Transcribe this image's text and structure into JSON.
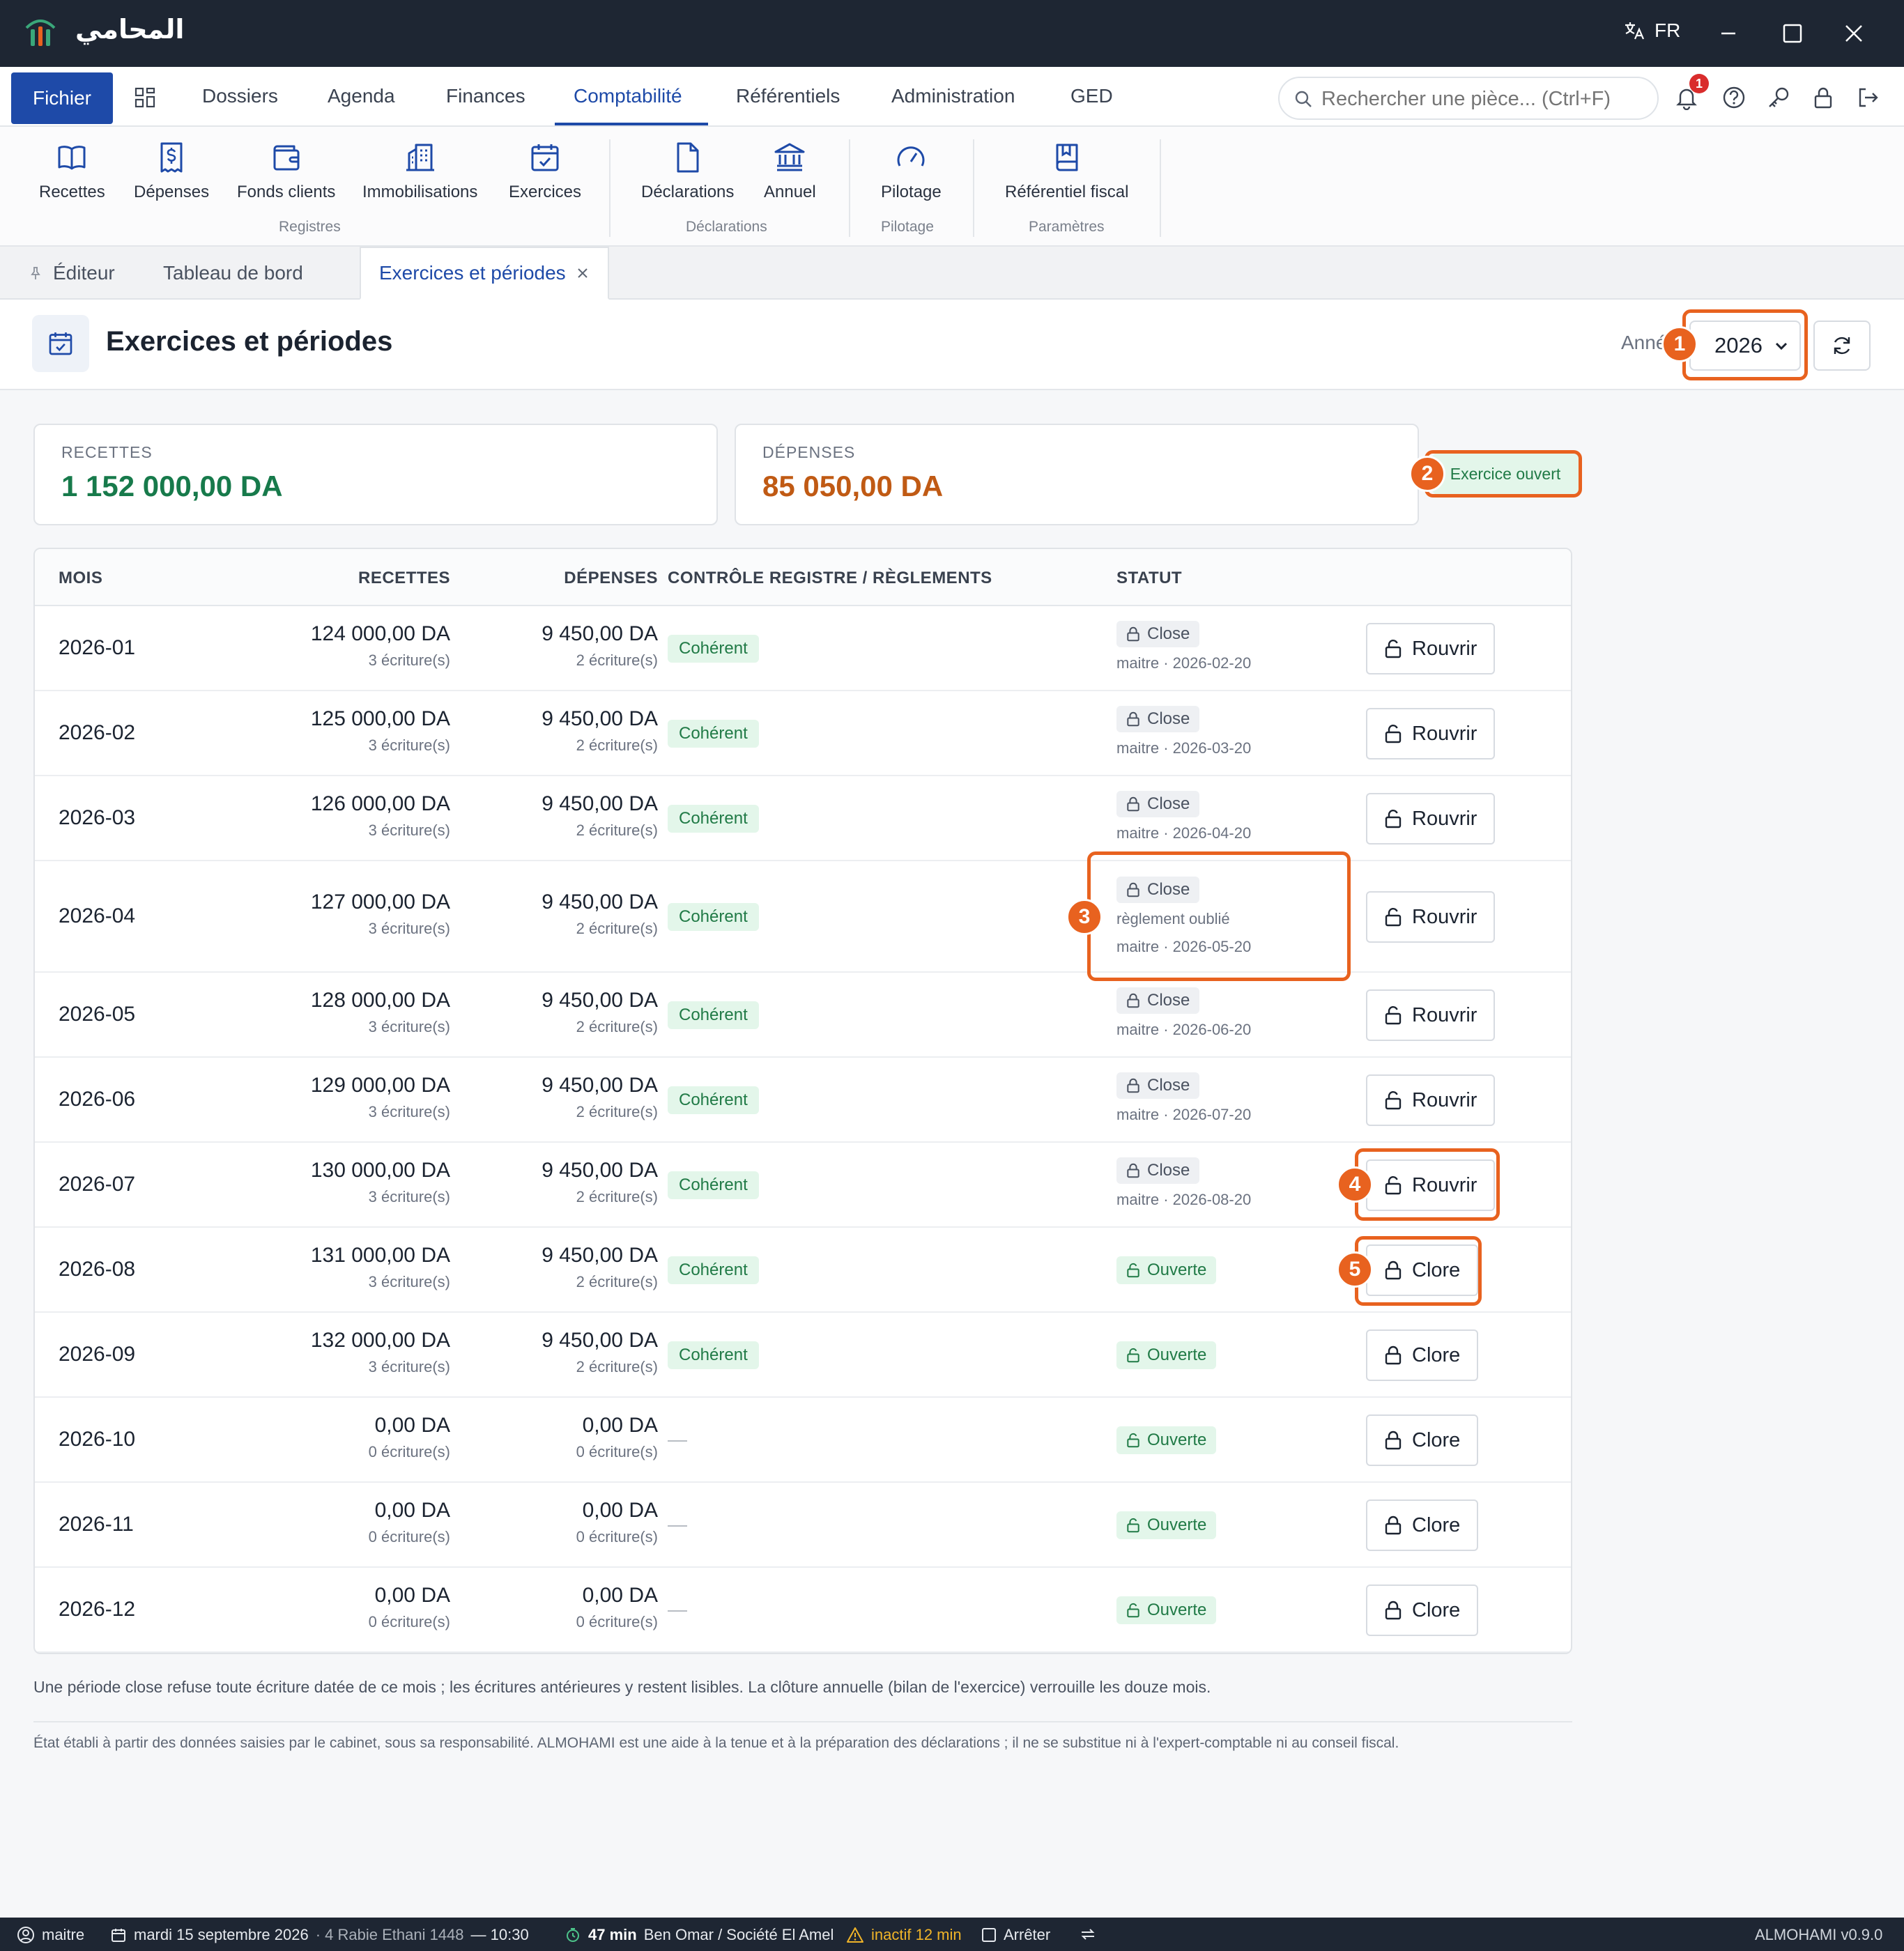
{
  "window": {
    "app_name": "المحامي",
    "lang": "FR"
  },
  "menu": {
    "fichier": "Fichier",
    "items": [
      "Dossiers",
      "Agenda",
      "Finances",
      "Comptabilité",
      "Référentiels",
      "Administration",
      "GED"
    ],
    "active": "Comptabilité"
  },
  "search": {
    "placeholder": "Rechercher une pièce... (Ctrl+F)"
  },
  "notifications": {
    "count": "1"
  },
  "ribbon": {
    "buttons": [
      "Recettes",
      "Dépenses",
      "Fonds clients",
      "Immobilisations",
      "Exercices",
      "Déclarations",
      "Annuel",
      "Pilotage",
      "Référentiel fiscal"
    ],
    "groups": [
      "Registres",
      "Déclarations",
      "Pilotage",
      "Paramètres"
    ]
  },
  "tabs": [
    {
      "label": "Éditeur"
    },
    {
      "label": "Tableau de bord"
    },
    {
      "label": "Exercices et périodes"
    }
  ],
  "page": {
    "title": "Exercices et périodes",
    "year_label": "Année",
    "year_value": "2026"
  },
  "summary": {
    "recettes_label": "RECETTES",
    "recettes_value": "1 152 000,00 DA",
    "depenses_label": "DÉPENSES",
    "depenses_value": "85 050,00 DA",
    "exercice_status": "Exercice ouvert"
  },
  "colors": {
    "recettes": "#177a4b",
    "depenses": "#c05a14",
    "accent": "#1e4aa8",
    "highlight": "#e8621f"
  },
  "table": {
    "headers": [
      "MOIS",
      "RECETTES",
      "DÉPENSES",
      "CONTRÔLE REGISTRE / RÈGLEMENTS",
      "STATUT"
    ],
    "rows": [
      {
        "mois": "2026-01",
        "rec": "124 000,00 DA",
        "rec_cnt": "3 écriture(s)",
        "dep": "9 450,00 DA",
        "dep_cnt": "2 écriture(s)",
        "controle": "Cohérent",
        "statut": "Close",
        "note": "",
        "meta": "maitre · 2026-02-20",
        "action": "Rouvrir"
      },
      {
        "mois": "2026-02",
        "rec": "125 000,00 DA",
        "rec_cnt": "3 écriture(s)",
        "dep": "9 450,00 DA",
        "dep_cnt": "2 écriture(s)",
        "controle": "Cohérent",
        "statut": "Close",
        "note": "",
        "meta": "maitre · 2026-03-20",
        "action": "Rouvrir"
      },
      {
        "mois": "2026-03",
        "rec": "126 000,00 DA",
        "rec_cnt": "3 écriture(s)",
        "dep": "9 450,00 DA",
        "dep_cnt": "2 écriture(s)",
        "controle": "Cohérent",
        "statut": "Close",
        "note": "",
        "meta": "maitre · 2026-04-20",
        "action": "Rouvrir"
      },
      {
        "mois": "2026-04",
        "rec": "127 000,00 DA",
        "rec_cnt": "3 écriture(s)",
        "dep": "9 450,00 DA",
        "dep_cnt": "2 écriture(s)",
        "controle": "Cohérent",
        "statut": "Close",
        "note": "règlement oublié",
        "meta": "maitre · 2026-05-20",
        "action": "Rouvrir"
      },
      {
        "mois": "2026-05",
        "rec": "128 000,00 DA",
        "rec_cnt": "3 écriture(s)",
        "dep": "9 450,00 DA",
        "dep_cnt": "2 écriture(s)",
        "controle": "Cohérent",
        "statut": "Close",
        "note": "",
        "meta": "maitre · 2026-06-20",
        "action": "Rouvrir"
      },
      {
        "mois": "2026-06",
        "rec": "129 000,00 DA",
        "rec_cnt": "3 écriture(s)",
        "dep": "9 450,00 DA",
        "dep_cnt": "2 écriture(s)",
        "controle": "Cohérent",
        "statut": "Close",
        "note": "",
        "meta": "maitre · 2026-07-20",
        "action": "Rouvrir"
      },
      {
        "mois": "2026-07",
        "rec": "130 000,00 DA",
        "rec_cnt": "3 écriture(s)",
        "dep": "9 450,00 DA",
        "dep_cnt": "2 écriture(s)",
        "controle": "Cohérent",
        "statut": "Close",
        "note": "",
        "meta": "maitre · 2026-08-20",
        "action": "Rouvrir"
      },
      {
        "mois": "2026-08",
        "rec": "131 000,00 DA",
        "rec_cnt": "3 écriture(s)",
        "dep": "9 450,00 DA",
        "dep_cnt": "2 écriture(s)",
        "controle": "Cohérent",
        "statut": "Ouverte",
        "note": "",
        "meta": "",
        "action": "Clore"
      },
      {
        "mois": "2026-09",
        "rec": "132 000,00 DA",
        "rec_cnt": "3 écriture(s)",
        "dep": "9 450,00 DA",
        "dep_cnt": "2 écriture(s)",
        "controle": "Cohérent",
        "statut": "Ouverte",
        "note": "",
        "meta": "",
        "action": "Clore"
      },
      {
        "mois": "2026-10",
        "rec": "0,00 DA",
        "rec_cnt": "0 écriture(s)",
        "dep": "0,00 DA",
        "dep_cnt": "0 écriture(s)",
        "controle": "—",
        "statut": "Ouverte",
        "note": "",
        "meta": "",
        "action": "Clore"
      },
      {
        "mois": "2026-11",
        "rec": "0,00 DA",
        "rec_cnt": "0 écriture(s)",
        "dep": "0,00 DA",
        "dep_cnt": "0 écriture(s)",
        "controle": "—",
        "statut": "Ouverte",
        "note": "",
        "meta": "",
        "action": "Clore"
      },
      {
        "mois": "2026-12",
        "rec": "0,00 DA",
        "rec_cnt": "0 écriture(s)",
        "dep": "0,00 DA",
        "dep_cnt": "0 écriture(s)",
        "controle": "—",
        "statut": "Ouverte",
        "note": "",
        "meta": "",
        "action": "Clore"
      }
    ]
  },
  "footer": {
    "note": "Une période close refuse toute écriture datée de ce mois ; les écritures antérieures y restent lisibles. La clôture annuelle (bilan de l'exercice) verrouille les douze mois.",
    "disclaimer": "État établi à partir des données saisies par le cabinet, sous sa responsabilité. ALMOHAMI est une aide à la tenue et à la préparation des déclarations ; il ne se substitue ni à l'expert-comptable ni au conseil fiscal."
  },
  "statusbar": {
    "user": "maitre",
    "date": "mardi 15 septembre 2026",
    "hijri": "· 4 Rabie Ethani 1448",
    "time": "— 10:30",
    "timer": "47 min",
    "dossier": "Ben Omar / Société El Amel",
    "inactive": "inactif 12 min",
    "stop": "Arrêter",
    "version": "ALMOHAMI v0.9.0"
  },
  "highlights": [
    "1",
    "2",
    "3",
    "4",
    "5"
  ]
}
